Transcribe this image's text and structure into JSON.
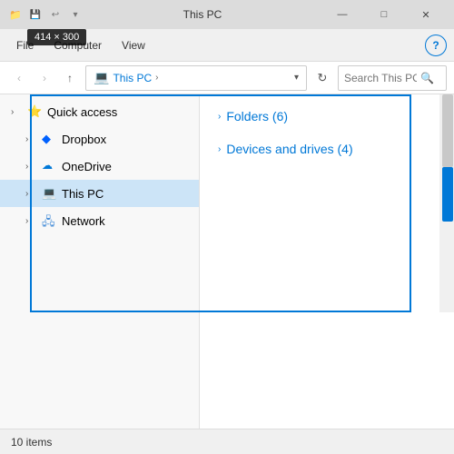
{
  "window": {
    "title": "This PC",
    "dimension_badge": "414 × 300"
  },
  "ribbon": {
    "tabs": [
      {
        "id": "file",
        "label": "File",
        "active": false
      },
      {
        "id": "computer",
        "label": "Computer",
        "active": false
      },
      {
        "id": "view",
        "label": "View",
        "active": false
      }
    ]
  },
  "address_bar": {
    "back_title": "Back",
    "forward_title": "Forward",
    "up_title": "Up",
    "path_icon": "💻",
    "path_computer": "This PC",
    "path_arrow": "›",
    "refresh_title": "Refresh",
    "search_placeholder": "Search This PC",
    "search_icon": "🔍"
  },
  "sidebar": {
    "items": [
      {
        "id": "quick-access",
        "label": "Quick access",
        "icon": "⭐",
        "expanded": false,
        "indent": 0
      },
      {
        "id": "dropbox",
        "label": "Dropbox",
        "icon": "◆",
        "expanded": false,
        "indent": 1
      },
      {
        "id": "onedrive",
        "label": "OneDrive",
        "icon": "☁",
        "expanded": false,
        "indent": 1
      },
      {
        "id": "this-pc",
        "label": "This PC",
        "icon": "💻",
        "expanded": false,
        "indent": 1,
        "active": true
      },
      {
        "id": "network",
        "label": "Network",
        "icon": "🖧",
        "expanded": false,
        "indent": 1
      }
    ]
  },
  "content": {
    "sections": [
      {
        "id": "folders",
        "title": "Folders (6)",
        "arrow": "›"
      },
      {
        "id": "devices-drives",
        "title": "Devices and drives (4)",
        "arrow": "›"
      }
    ]
  },
  "status_bar": {
    "item_count": "10 items"
  },
  "window_controls": {
    "minimize": "—",
    "maximize": "□",
    "close": "✕"
  }
}
